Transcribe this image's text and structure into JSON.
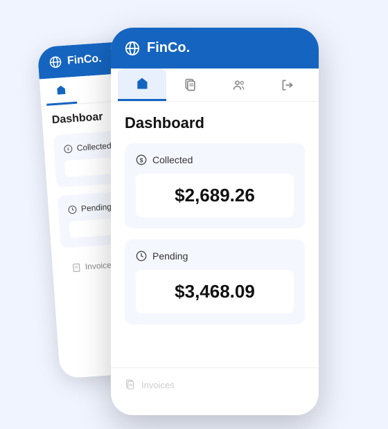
{
  "app": {
    "name": "FinCo.",
    "globe_icon": "🌐"
  },
  "nav": {
    "items": [
      {
        "label": "Home",
        "icon": "home",
        "active": true
      },
      {
        "label": "Documents",
        "icon": "documents",
        "active": false
      },
      {
        "label": "Team",
        "icon": "team",
        "active": false
      },
      {
        "label": "Exit",
        "icon": "exit",
        "active": false
      }
    ]
  },
  "dashboard": {
    "title": "Dashboard",
    "collected": {
      "label": "Collected",
      "value": "$2,689.26"
    },
    "pending": {
      "label": "Pending",
      "value": "$3,468.09"
    },
    "invoices": {
      "label": "Invoices"
    }
  }
}
